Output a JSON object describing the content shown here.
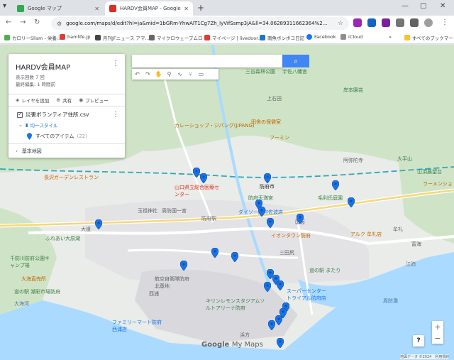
{
  "browser": {
    "tabs": [
      {
        "title": "Google マップ",
        "active": false,
        "icon": "google-maps-favicon"
      },
      {
        "title": "HARDV会員MAP - Google マイ…",
        "active": true,
        "icon": "my-maps-favicon"
      }
    ],
    "new_tab": "+",
    "url": "google.com/maps/d/edit?hl=ja&mid=1bGRm-YhwAIT1Cg7Zh_lyVifSsmp3jA&ll=34.06289311662364%2…",
    "bookmarks": [
      {
        "label": "カロリーSlism - 栄養…",
        "color": "#4caf50"
      },
      {
        "label": "hamlife.jp",
        "color": "#e53935"
      },
      {
        "label": "月刊JFニュース アマ…",
        "color": "#444444"
      },
      {
        "label": "マイクロウェーブムロ・…",
        "color": "#666666"
      },
      {
        "label": "マイページ | livedoor…",
        "color": "#e53935"
      },
      {
        "label": "南魚ボンボコ日記",
        "color": "#1976d2"
      },
      {
        "label": "Facebook",
        "color": "#1877f2"
      },
      {
        "label": "iCloud",
        "color": "#8e8e8e"
      }
    ],
    "all_bookmarks": "すべてのブックマーク",
    "more_bookmarks": "»"
  },
  "panel": {
    "title": "HARDV会員MAP",
    "views": "表示回数 7 回",
    "last_edit": "最終編集: 1 時間前",
    "actions": [
      "レイヤを追加",
      "共有",
      "プレビュー"
    ],
    "layer_name": "災害ボランティア住所.csv",
    "style_label": "均一スタイル",
    "items_label": "すべてのアイテム",
    "items_count": "(22)",
    "basemap_label": "基本地図"
  },
  "map": {
    "labels": [
      "三谷森林公園",
      "宇佐八幡宮",
      "上右田",
      "岸本園芸",
      "カレーショップ・ジパング(JIPANG)",
      "田舎の保健室",
      "フーミン",
      "大平山",
      "山頂展望台",
      "阿弥陀寺",
      "長沢ガーデンレストラン",
      "山口県立総合医療センター",
      "防府市",
      "防府天満宮",
      "毛利氏庭園",
      "ラーメンショ",
      "玉祖神社",
      "周防国一宮",
      "防府駅",
      "ダイソー防府佐波店",
      "国衙",
      "牟礼",
      "大道",
      "ふれあい大原湖",
      "イオンタウン防府",
      "アルク 牟礼店",
      "三田尻",
      "富海",
      "千防川防府公園キャンプ場",
      "大海直売所",
      "道の駅 潮彩市場防府",
      "航空自衛隊防府北基地",
      "西浦",
      "スーパーセンタートライアル防府店",
      "キリンレモンスタジアムソルトアリーナ防府",
      "ファミリーマート防府西浦店",
      "浜方",
      "道の駅 またり",
      "周防灘",
      "江泊",
      "大海湾",
      "上右田"
    ],
    "poi_label_color": "#3c7d4a",
    "road_color": "#ffffff",
    "water_color": "#aadaff",
    "pin_color": "#1a73e8",
    "pin_count": 22,
    "attribution": "地図データ ©2024　利用規約",
    "logo_google": "Google",
    "logo_mymaps": "My Maps"
  },
  "controls": {
    "zoom_in": "+",
    "zoom_out": "−",
    "help": "?"
  }
}
